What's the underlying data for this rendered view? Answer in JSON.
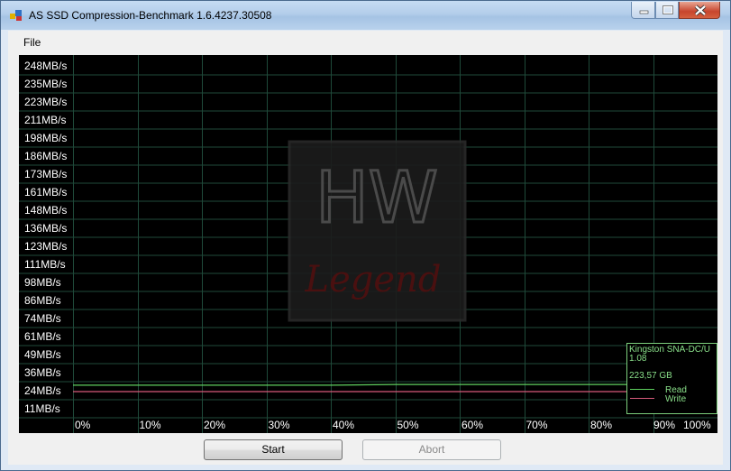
{
  "window": {
    "title": "AS SSD Compression-Benchmark 1.6.4237.30508",
    "controls": [
      "minimize",
      "maximize",
      "close"
    ]
  },
  "menu": {
    "file": "File"
  },
  "chart_data": {
    "type": "line",
    "y_tick_labels": [
      "248MB/s",
      "235MB/s",
      "223MB/s",
      "211MB/s",
      "198MB/s",
      "186MB/s",
      "173MB/s",
      "161MB/s",
      "148MB/s",
      "136MB/s",
      "123MB/s",
      "111MB/s",
      "98MB/s",
      "86MB/s",
      "74MB/s",
      "61MB/s",
      "49MB/s",
      "36MB/s",
      "24MB/s",
      "11MB/s"
    ],
    "x_tick_labels": [
      "0%",
      "10%",
      "20%",
      "30%",
      "40%",
      "50%",
      "60%",
      "70%",
      "80%",
      "90%",
      "100%"
    ],
    "x": [
      0,
      10,
      20,
      30,
      40,
      50,
      60,
      70,
      80,
      90,
      100
    ],
    "series": [
      {
        "name": "Read",
        "color": "#5fd05f",
        "values": [
          23,
          23,
          23,
          23,
          23,
          23.5,
          23.5,
          23.5,
          23.5,
          23.5,
          23.5
        ]
      },
      {
        "name": "Write",
        "color": "#d65a7a",
        "values": [
          18.5,
          18.5,
          18.5,
          18.5,
          18.5,
          18.5,
          18.5,
          18.5,
          18.5,
          18.5,
          18.5
        ]
      }
    ],
    "ylim": [
      0,
      255
    ],
    "grid": true,
    "legend": {
      "placement": "bottom-right",
      "drive": "Kingston SNA-DC/U",
      "firmware": "1.08",
      "capacity": "223,57 GB",
      "read_label": "Read",
      "write_label": "Write"
    }
  },
  "buttons": {
    "start": "Start",
    "abort": "Abort"
  },
  "watermark": {
    "top": "HW",
    "bottom": "Legend"
  }
}
